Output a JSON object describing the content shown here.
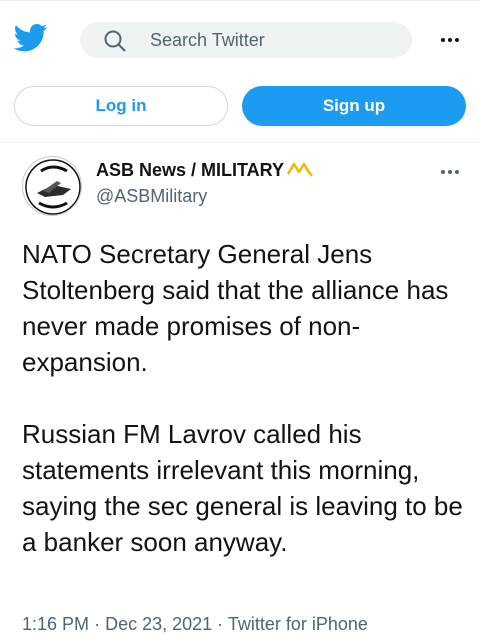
{
  "header": {
    "search_placeholder": "Search Twitter"
  },
  "auth": {
    "login_label": "Log in",
    "signup_label": "Sign up"
  },
  "tweet": {
    "author_name": "ASB News / MILITARY",
    "author_handle": "@ASBMilitary",
    "paragraphs": [
      "NATO Secretary General Jens Stoltenberg said that the alliance has never made promises of non-expansion.",
      "Russian FM Lavrov called his statements irrelevant this morning, saying the sec general is leaving to be a banker soon anyway."
    ],
    "time": "1:16 PM",
    "date": "Dec 23, 2021",
    "source": "Twitter for iPhone",
    "separator": "·"
  },
  "avatar_text": "ASB NEWS MILITARY",
  "colors": {
    "accent": "#1d9bf0",
    "text": "#0f1419",
    "muted": "#536471",
    "brand_mark": "#f2b600"
  },
  "icons": {
    "logo": "twitter-bird-icon",
    "search": "search-icon",
    "more": "more-dots-icon",
    "brand_mark": "brand-mark-icon"
  }
}
